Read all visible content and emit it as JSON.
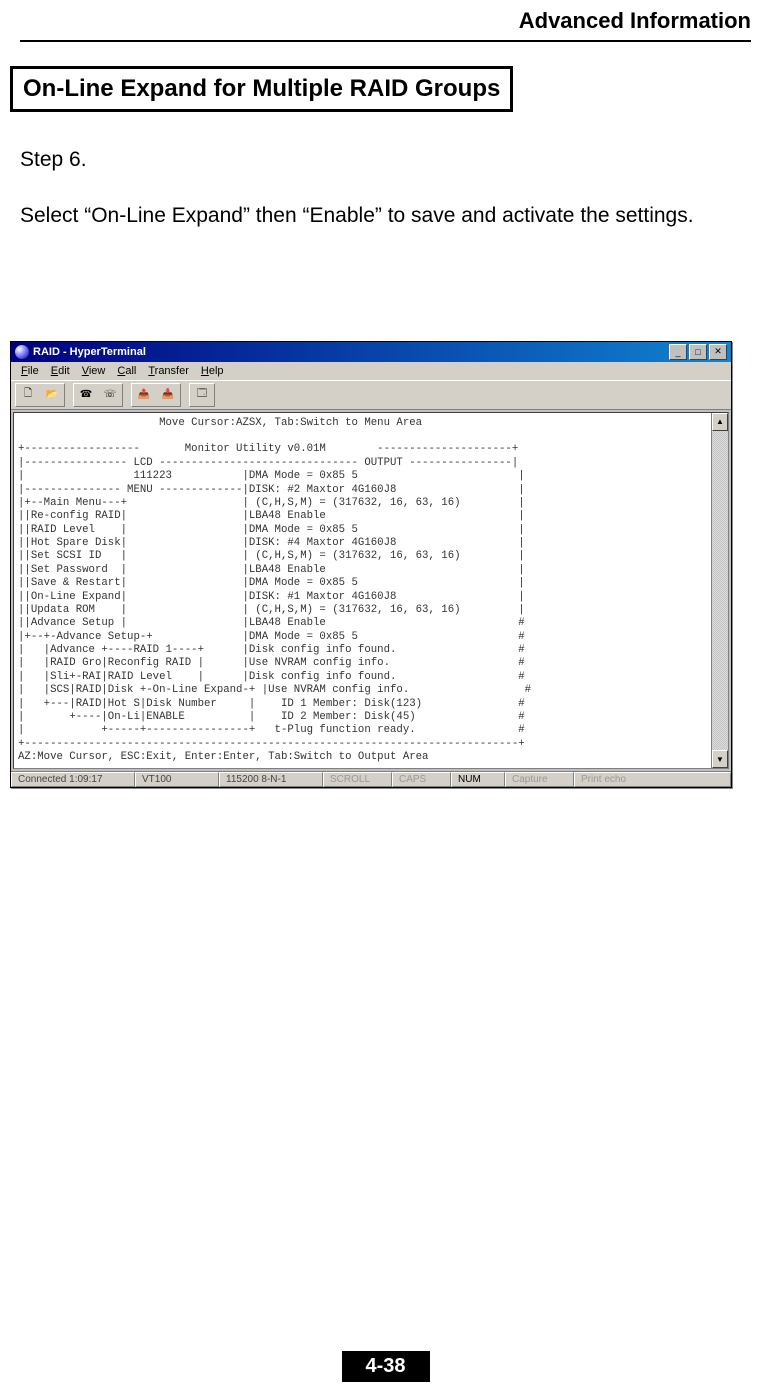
{
  "page": {
    "running_header": "Advanced Information",
    "section_title": "On-Line Expand for Multiple RAID Groups",
    "step_label": "Step 6.",
    "instruction": "Select “On-Line Expand” then “Enable” to save and activate the settings.",
    "page_number": "4-38"
  },
  "window": {
    "title": "RAID - HyperTerminal",
    "menu": {
      "file": "File",
      "edit": "Edit",
      "view": "View",
      "call": "Call",
      "transfer": "Transfer",
      "help": "Help"
    },
    "terminal_text": "                      Move Cursor:AZSX, Tab:Switch to Menu Area\n\n+------------------       Monitor Utility v0.01M        ---------------------+\n|---------------- LCD ------------------------------- OUTPUT ----------------|\n|                 111223           |DMA Mode = 0x85 5                         |\n|--------------- MENU -------------|DISK: #2 Maxtor 4G160J8                   |\n|+--Main Menu---+                  | (C,H,S,M) = (317632, 16, 63, 16)         |\n||Re-config RAID|                  |LBA48 Enable                              |\n||RAID Level    |                  |DMA Mode = 0x85 5                         |\n||Hot Spare Disk|                  |DISK: #4 Maxtor 4G160J8                   |\n||Set SCSI ID   |                  | (C,H,S,M) = (317632, 16, 63, 16)         |\n||Set Password  |                  |LBA48 Enable                              |\n||Save & Restart|                  |DMA Mode = 0x85 5                         |\n||On-Line Expand|                  |DISK: #1 Maxtor 4G160J8                   |\n||Updata ROM    |                  | (C,H,S,M) = (317632, 16, 63, 16)         |\n||Advance Setup |                  |LBA48 Enable                              #\n|+--+-Advance Setup-+              |DMA Mode = 0x85 5                         #\n|   |Advance +----RAID 1----+      |Disk config info found.                   #\n|   |RAID Gro|Reconfig RAID |      |Use NVRAM config info.                    #\n|   |Sli+-RAI|RAID Level    |      |Disk config info found.                   #\n|   |SCS|RAID|Disk +-On-Line Expand-+ |Use NVRAM config info.                  #\n|   +---|RAID|Hot S|Disk Number     |    ID 1 Member: Disk(123)               #\n|       +----|On-Li|ENABLE          |    ID 2 Member: Disk(45)                #\n|            +-----+----------------+   t-Plug function ready.                #\n+-----------------------------------------------------------------------------+\nAZ:Move Cursor, ESC:Exit, Enter:Enter, Tab:Switch to Output Area",
    "statusbar": {
      "connected": "Connected 1:09:17",
      "emulation": "VT100",
      "settings": "115200 8-N-1",
      "scroll": "SCROLL",
      "caps": "CAPS",
      "num": "NUM",
      "capture": "Capture",
      "printecho": "Print echo"
    }
  }
}
